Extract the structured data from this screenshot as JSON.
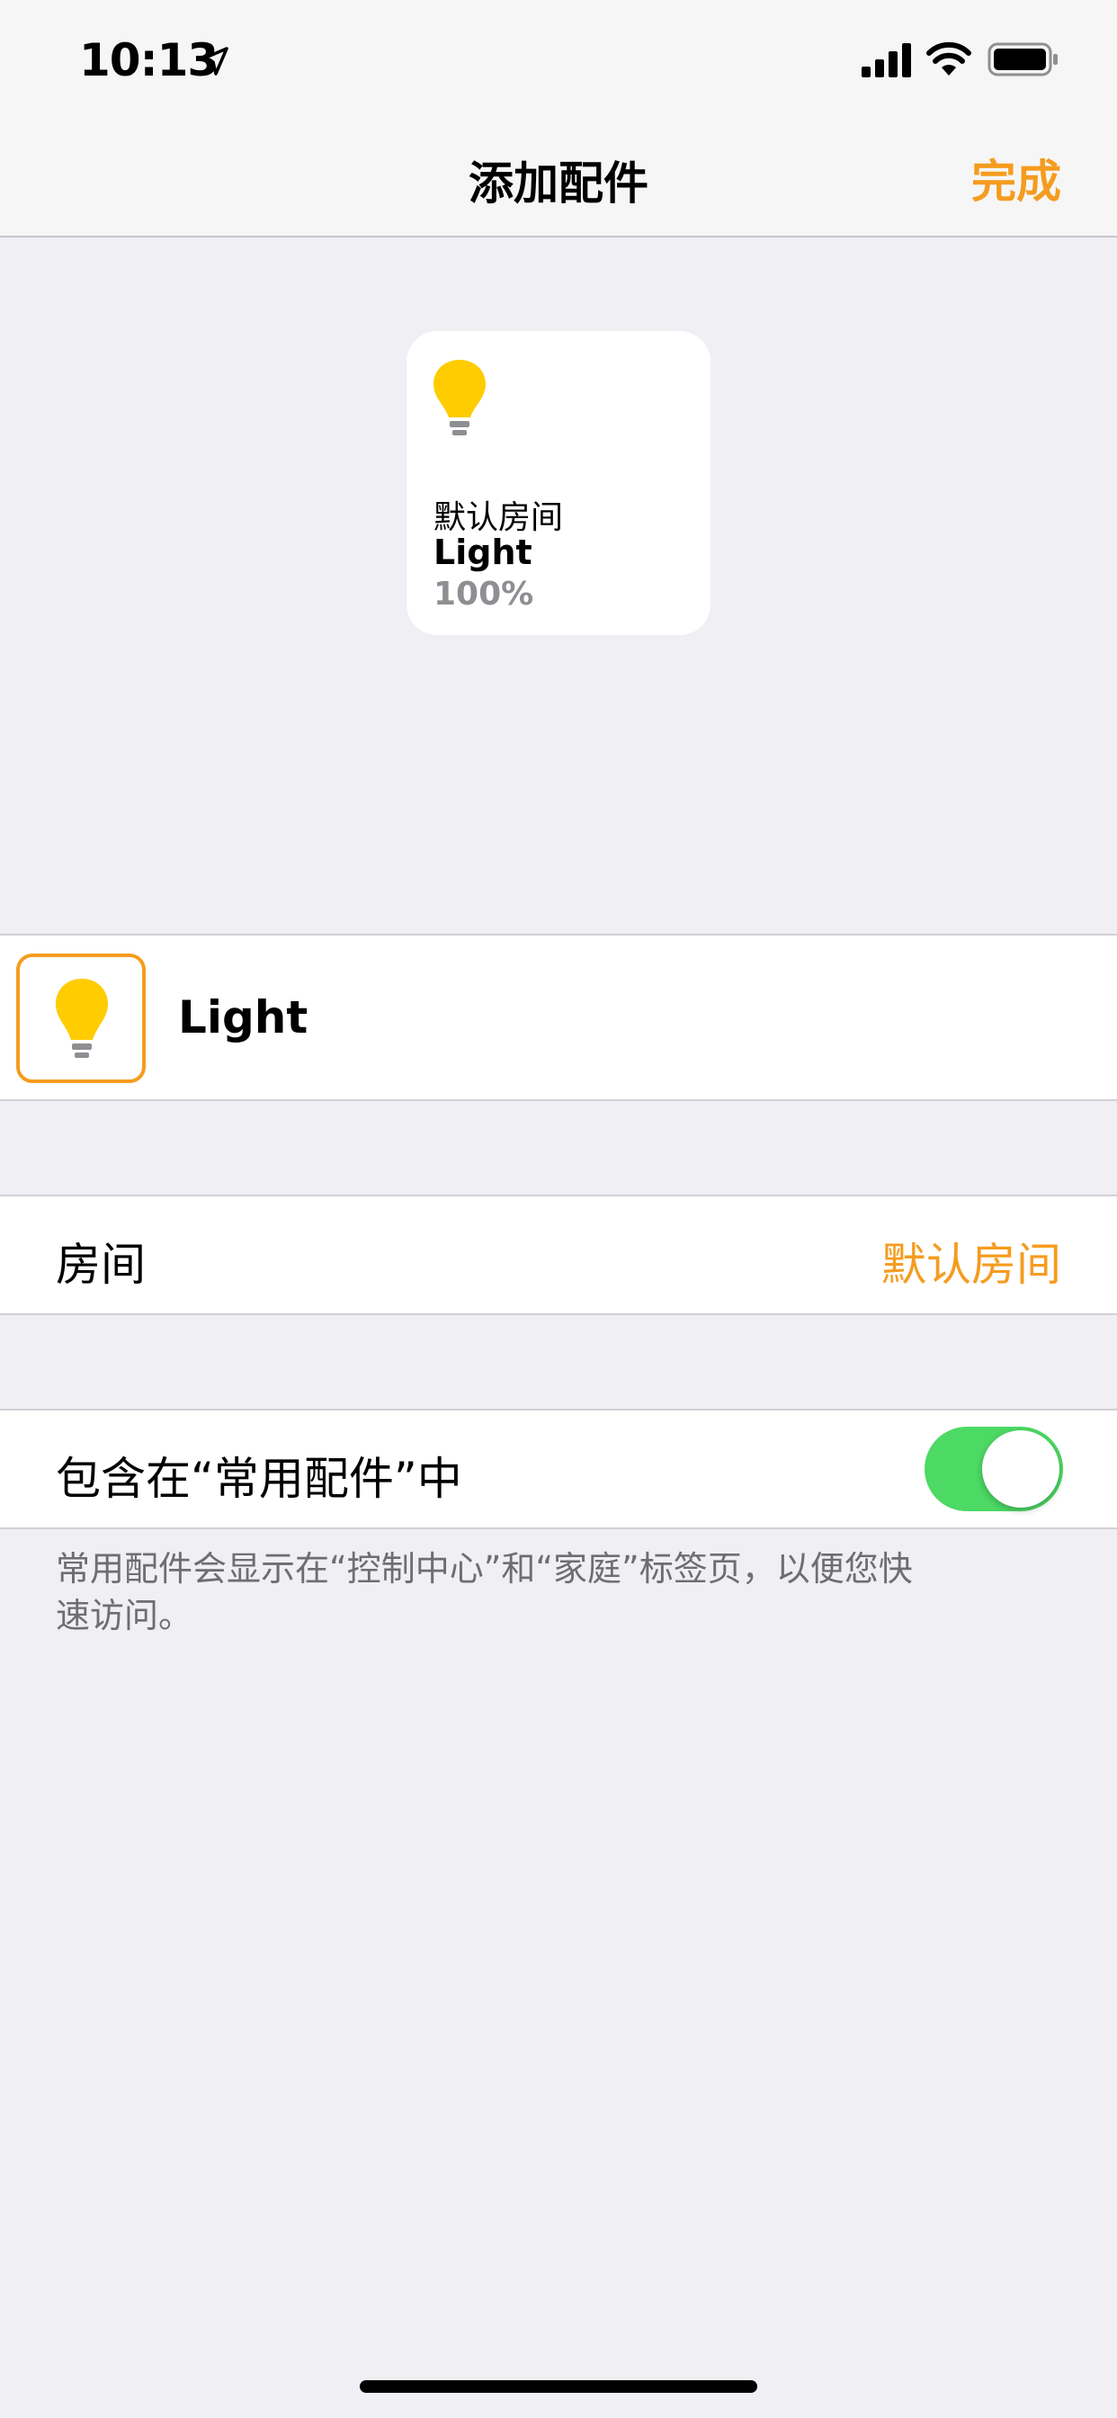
{
  "status_bar": {
    "time": "10:13"
  },
  "nav": {
    "title": "添加配件",
    "done_label": "完成"
  },
  "tile": {
    "room": "默认房间",
    "name": "Light",
    "brightness": "100%"
  },
  "accessory": {
    "name": "Light"
  },
  "room_row": {
    "label": "房间",
    "value": "默认房间"
  },
  "favorite_row": {
    "label": "包含在“常用配件”中",
    "enabled": true
  },
  "footnote": "常用配件会显示在“控制中心”和“家庭”标签页，以便您快速访问。",
  "colors": {
    "accent": "#f59c1f",
    "toggle_on": "#4cd964",
    "bulb": "#ffcc00"
  }
}
